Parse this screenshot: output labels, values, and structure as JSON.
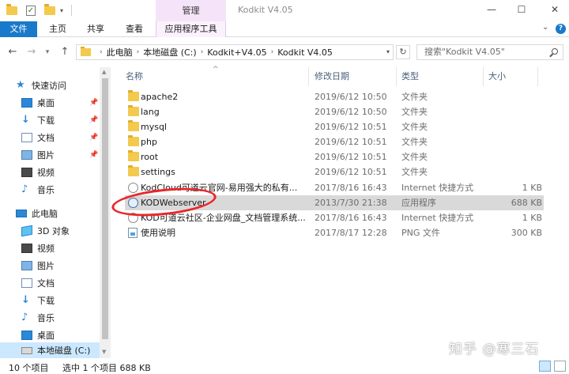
{
  "window": {
    "title": "Kodkit V4.05",
    "context_tab_group": "管理",
    "min_glyph": "—",
    "max_glyph": "☐",
    "close_glyph": "✕"
  },
  "ribbon": {
    "tabs": [
      "文件",
      "主页",
      "共享",
      "查看",
      "应用程序工具"
    ],
    "help_glyph": "?"
  },
  "address": {
    "crumbs": [
      "此电脑",
      "本地磁盘 (C:)",
      "Kodkit+V4.05",
      "Kodkit V4.05"
    ],
    "search_placeholder": "搜索\"Kodkit V4.05\""
  },
  "nav_pane": {
    "items": [
      {
        "label": "快速访问",
        "icon": "star-icon",
        "pinned": false
      },
      {
        "label": "桌面",
        "icon": "desktop-icon",
        "pinned": true
      },
      {
        "label": "下载",
        "icon": "download-icon",
        "pinned": true
      },
      {
        "label": "文档",
        "icon": "document-icon",
        "pinned": true
      },
      {
        "label": "图片",
        "icon": "picture-icon",
        "pinned": true
      },
      {
        "label": "视频",
        "icon": "video-icon",
        "pinned": false
      },
      {
        "label": "音乐",
        "icon": "music-icon",
        "pinned": false
      },
      {
        "label": "此电脑",
        "icon": "computer-icon",
        "pinned": false
      },
      {
        "label": "3D 对象",
        "icon": "3d-objects-icon",
        "pinned": false
      },
      {
        "label": "视频",
        "icon": "video-icon",
        "pinned": false
      },
      {
        "label": "图片",
        "icon": "picture-icon",
        "pinned": false
      },
      {
        "label": "文档",
        "icon": "document-icon",
        "pinned": false
      },
      {
        "label": "下载",
        "icon": "download-icon",
        "pinned": false
      },
      {
        "label": "音乐",
        "icon": "music-icon",
        "pinned": false
      },
      {
        "label": "桌面",
        "icon": "desktop-icon",
        "pinned": false
      },
      {
        "label": "本地磁盘 (C:)",
        "icon": "drive-icon",
        "pinned": false
      }
    ]
  },
  "file_list": {
    "columns": [
      "名称",
      "修改日期",
      "类型",
      "大小"
    ],
    "rows": [
      {
        "name": "apache2",
        "date": "2019/6/12 10:50",
        "type": "文件夹",
        "size": "",
        "icon": "folder-icon"
      },
      {
        "name": "lang",
        "date": "2019/6/12 10:50",
        "type": "文件夹",
        "size": "",
        "icon": "folder-icon"
      },
      {
        "name": "mysql",
        "date": "2019/6/12 10:51",
        "type": "文件夹",
        "size": "",
        "icon": "folder-icon"
      },
      {
        "name": "php",
        "date": "2019/6/12 10:51",
        "type": "文件夹",
        "size": "",
        "icon": "folder-icon"
      },
      {
        "name": "root",
        "date": "2019/6/12 10:51",
        "type": "文件夹",
        "size": "",
        "icon": "folder-icon"
      },
      {
        "name": "settings",
        "date": "2019/6/12 10:51",
        "type": "文件夹",
        "size": "",
        "icon": "folder-icon"
      },
      {
        "name": "KodCloud可道云官网-易用强大的私有...",
        "date": "2017/8/16 16:43",
        "type": "Internet 快捷方式",
        "size": "1 KB",
        "icon": "internet-shortcut-icon"
      },
      {
        "name": "KODWebserver",
        "date": "2013/7/30 21:38",
        "type": "应用程序",
        "size": "688 KB",
        "icon": "application-icon",
        "selected": true
      },
      {
        "name": "KOD可道云社区-企业网盘_文档管理系统...",
        "date": "2017/8/16 16:43",
        "type": "Internet 快捷方式",
        "size": "1 KB",
        "icon": "internet-shortcut-icon"
      },
      {
        "name": "使用说明",
        "date": "2017/8/17 12:28",
        "type": "PNG 文件",
        "size": "300 KB",
        "icon": "png-file-icon"
      }
    ]
  },
  "status_bar": {
    "item_count": "10 个项目",
    "selection": "选中 1 个项目  688 KB"
  },
  "watermark": "知乎 @寒三石",
  "colors": {
    "accent": "#1979ca",
    "selection": "#d9d9d9",
    "annotation": "#e8272b",
    "context_tab": "#f5e4f9"
  }
}
